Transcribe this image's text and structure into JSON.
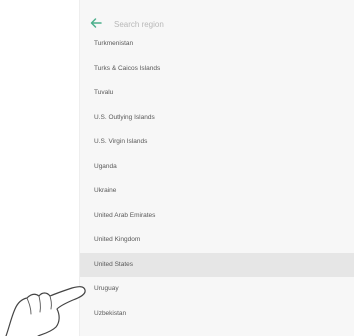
{
  "search": {
    "placeholder": "Search region",
    "back_icon": "arrow-left-icon"
  },
  "regions": [
    {
      "label": "Turkmenistan",
      "selected": false
    },
    {
      "label": "Turks & Caicos Islands",
      "selected": false
    },
    {
      "label": "Tuvalu",
      "selected": false
    },
    {
      "label": "U.S. Outlying Islands",
      "selected": false
    },
    {
      "label": "U.S. Virgin Islands",
      "selected": false
    },
    {
      "label": "Uganda",
      "selected": false
    },
    {
      "label": "Ukraine",
      "selected": false
    },
    {
      "label": "United Arab Emirates",
      "selected": false
    },
    {
      "label": "United Kingdom",
      "selected": false
    },
    {
      "label": "United States",
      "selected": true
    },
    {
      "label": "Uruguay",
      "selected": false
    },
    {
      "label": "Uzbekistan",
      "selected": false
    }
  ],
  "colors": {
    "accent": "#4caf8c",
    "selected_row": "#e6e6e6",
    "panel_background": "#f7f7f7"
  },
  "pointer_icon": "hand-pointer-icon"
}
